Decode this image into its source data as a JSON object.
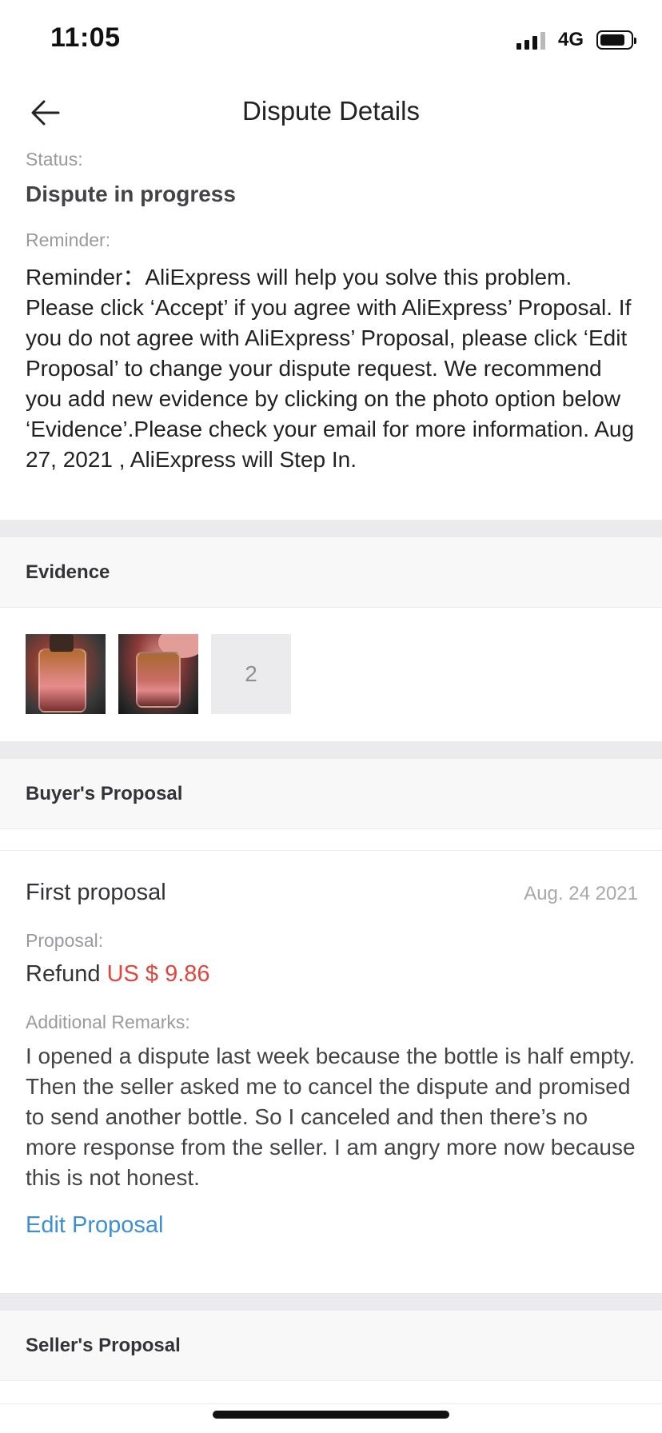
{
  "status_bar": {
    "time": "11:05",
    "network": "4G"
  },
  "nav": {
    "title": "Dispute Details",
    "back_icon": "arrow-left-icon"
  },
  "status": {
    "label": "Status:",
    "value": "Dispute in progress"
  },
  "reminder": {
    "label": "Reminder:",
    "text": "Reminder：AliExpress will help you solve this problem. Please click ‘Accept’ if you agree with AliExpress’ Proposal. If you do not agree with AliExpress’ Proposal, please click ‘Edit Proposal’ to change your dispute request. We recommend you add new evidence by clicking on the photo option below ‘Evidence’.Please check your email for more information. Aug 27, 2021 , AliExpress will Step In."
  },
  "evidence": {
    "header": "Evidence",
    "more_count": "2"
  },
  "buyer_proposal": {
    "header": "Buyer's Proposal",
    "title": "First proposal",
    "date": "Aug. 24 2021",
    "proposal_label": "Proposal:",
    "refund_prefix": "Refund",
    "refund_amount": "US $ 9.86",
    "remarks_label": "Additional Remarks:",
    "remarks_text": "I opened a dispute last week because the bottle is half empty. Then the seller asked me to cancel the dispute and promised to send another bottle. So I canceled and then there’s no more response from the seller. I am angry more now because this is not honest.",
    "edit_label": "Edit Proposal"
  },
  "seller_proposal": {
    "header": "Seller's Proposal"
  },
  "colors": {
    "accent_link": "#3f8fd6",
    "price_red": "#e0463d",
    "divider": "#ebebed"
  }
}
